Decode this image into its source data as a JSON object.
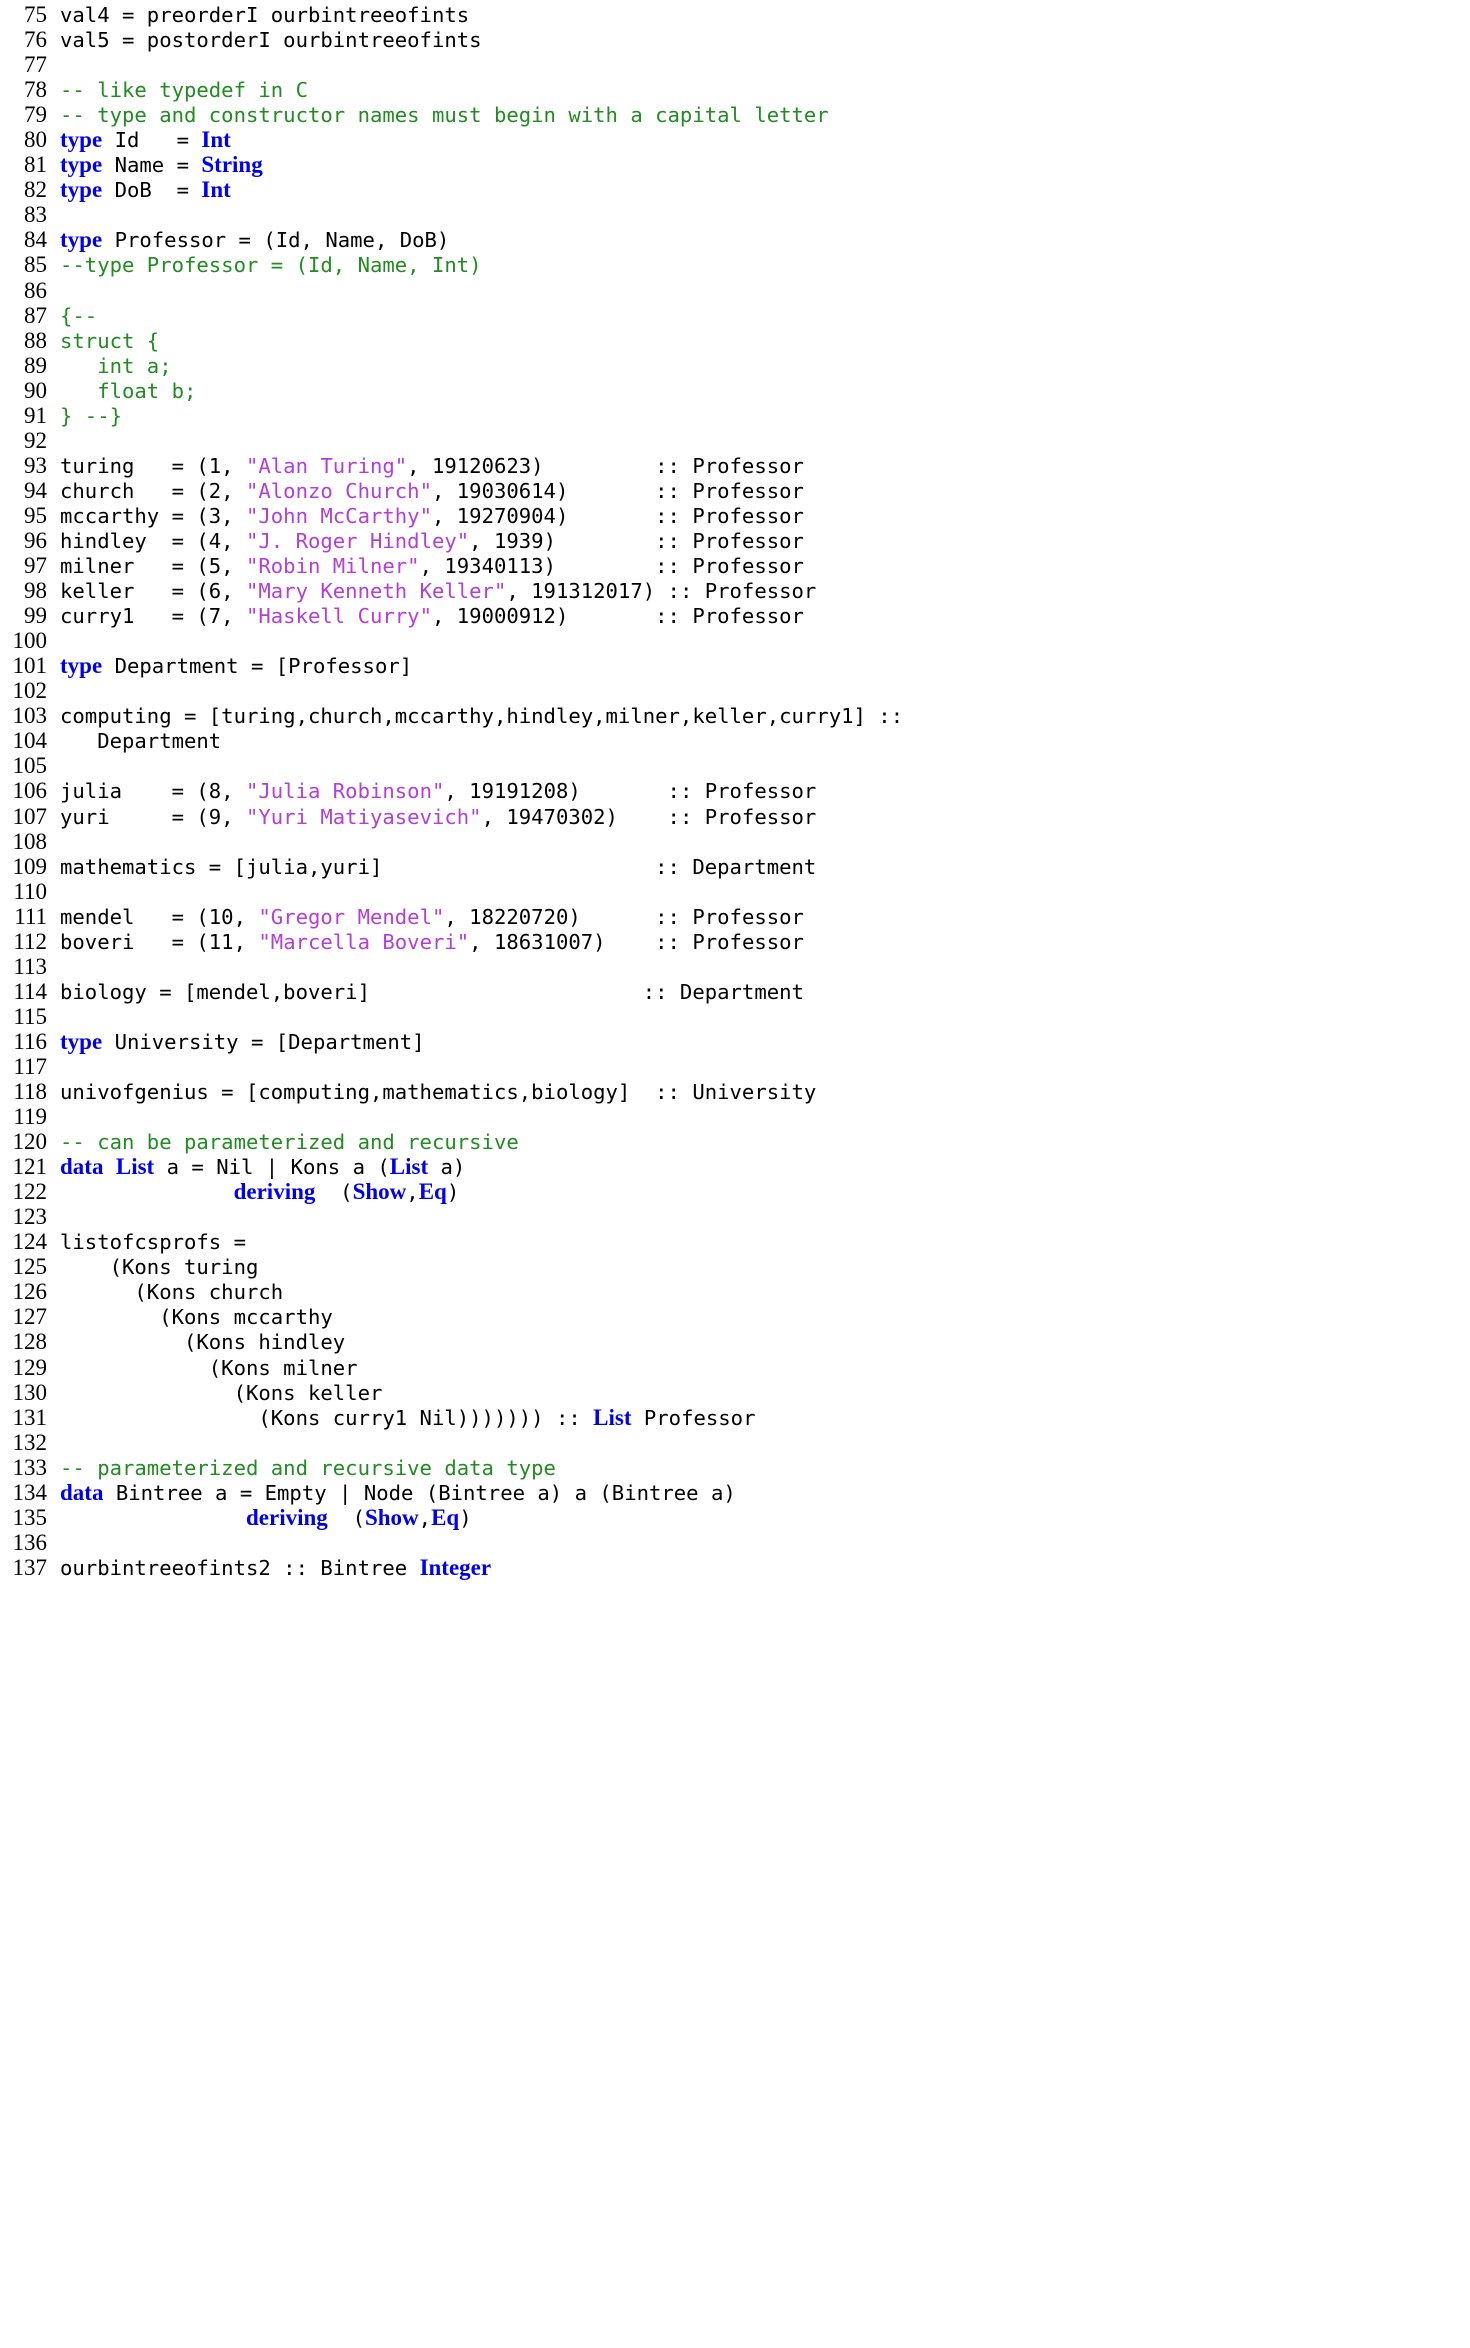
{
  "editor": {
    "language": "Haskell",
    "first_line_number": 75,
    "last_line_number": 137,
    "colors": {
      "background": "#ffffff",
      "default_text": "#000000",
      "keyword": "#0000EE",
      "type": "#0000EE",
      "comment": "#228B22",
      "string": "#B23FD8",
      "line_number": "#000000"
    }
  },
  "lines": [
    {
      "n": "75",
      "tokens": [
        {
          "t": "val4 = preorderI ourbintreeofints",
          "c": "pl"
        }
      ]
    },
    {
      "n": "76",
      "tokens": [
        {
          "t": "val5 = postorderI ourbintreeofints",
          "c": "pl"
        }
      ]
    },
    {
      "n": "77",
      "tokens": []
    },
    {
      "n": "78",
      "tokens": [
        {
          "t": "-- like typedef in C",
          "c": "cm"
        }
      ]
    },
    {
      "n": "79",
      "tokens": [
        {
          "t": "-- type and constructor names must begin with a capital letter",
          "c": "cm"
        }
      ]
    },
    {
      "n": "80",
      "tokens": [
        {
          "t": "type",
          "c": "kw"
        },
        {
          "t": " Id   = ",
          "c": "pl"
        },
        {
          "t": "Int",
          "c": "ty"
        }
      ]
    },
    {
      "n": "81",
      "tokens": [
        {
          "t": "type",
          "c": "kw"
        },
        {
          "t": " Name = ",
          "c": "pl"
        },
        {
          "t": "String",
          "c": "ty"
        }
      ]
    },
    {
      "n": "82",
      "tokens": [
        {
          "t": "type",
          "c": "kw"
        },
        {
          "t": " DoB  = ",
          "c": "pl"
        },
        {
          "t": "Int",
          "c": "ty"
        }
      ]
    },
    {
      "n": "83",
      "tokens": []
    },
    {
      "n": "84",
      "tokens": [
        {
          "t": "type",
          "c": "kw"
        },
        {
          "t": " Professor = (Id, Name, DoB)",
          "c": "pl"
        }
      ]
    },
    {
      "n": "85",
      "tokens": [
        {
          "t": "--type Professor = (Id, Name, Int)",
          "c": "cm"
        }
      ]
    },
    {
      "n": "86",
      "tokens": []
    },
    {
      "n": "87",
      "tokens": [
        {
          "t": "{--",
          "c": "cm"
        }
      ]
    },
    {
      "n": "88",
      "tokens": [
        {
          "t": "struct {",
          "c": "cm"
        }
      ]
    },
    {
      "n": "89",
      "tokens": [
        {
          "t": "   int a;",
          "c": "cm"
        }
      ]
    },
    {
      "n": "90",
      "tokens": [
        {
          "t": "   float b;",
          "c": "cm"
        }
      ]
    },
    {
      "n": "91",
      "tokens": [
        {
          "t": "} --}",
          "c": "cm"
        }
      ]
    },
    {
      "n": "92",
      "tokens": []
    },
    {
      "n": "93",
      "tokens": [
        {
          "t": "turing   = (1, ",
          "c": "pl"
        },
        {
          "t": "\"Alan Turing\"",
          "c": "st"
        },
        {
          "t": ", 19120623)         :: Professor",
          "c": "pl"
        }
      ]
    },
    {
      "n": "94",
      "tokens": [
        {
          "t": "church   = (2, ",
          "c": "pl"
        },
        {
          "t": "\"Alonzo Church\"",
          "c": "st"
        },
        {
          "t": ", 19030614)       :: Professor",
          "c": "pl"
        }
      ]
    },
    {
      "n": "95",
      "tokens": [
        {
          "t": "mccarthy = (3, ",
          "c": "pl"
        },
        {
          "t": "\"John McCarthy\"",
          "c": "st"
        },
        {
          "t": ", 19270904)       :: Professor",
          "c": "pl"
        }
      ]
    },
    {
      "n": "96",
      "tokens": [
        {
          "t": "hindley  = (4, ",
          "c": "pl"
        },
        {
          "t": "\"J. Roger Hindley\"",
          "c": "st"
        },
        {
          "t": ", 1939)        :: Professor",
          "c": "pl"
        }
      ]
    },
    {
      "n": "97",
      "tokens": [
        {
          "t": "milner   = (5, ",
          "c": "pl"
        },
        {
          "t": "\"Robin Milner\"",
          "c": "st"
        },
        {
          "t": ", 19340113)        :: Professor",
          "c": "pl"
        }
      ]
    },
    {
      "n": "98",
      "tokens": [
        {
          "t": "keller   = (6, ",
          "c": "pl"
        },
        {
          "t": "\"Mary Kenneth Keller\"",
          "c": "st"
        },
        {
          "t": ", 191312017) :: Professor",
          "c": "pl"
        }
      ]
    },
    {
      "n": "99",
      "tokens": [
        {
          "t": "curry1   = (7, ",
          "c": "pl"
        },
        {
          "t": "\"Haskell Curry\"",
          "c": "st"
        },
        {
          "t": ", 19000912)       :: Professor",
          "c": "pl"
        }
      ]
    },
    {
      "n": "100",
      "tokens": []
    },
    {
      "n": "101",
      "tokens": [
        {
          "t": "type",
          "c": "kw"
        },
        {
          "t": " Department = [Professor]",
          "c": "pl"
        }
      ]
    },
    {
      "n": "102",
      "tokens": []
    },
    {
      "n": "103",
      "tokens": [
        {
          "t": "computing = [turing,church,mccarthy,hindley,milner,keller,curry1] ::",
          "c": "pl"
        }
      ]
    },
    {
      "n": "104",
      "tokens": [
        {
          "t": "   Department",
          "c": "pl"
        }
      ]
    },
    {
      "n": "105",
      "tokens": []
    },
    {
      "n": "106",
      "tokens": [
        {
          "t": "julia    = (8, ",
          "c": "pl"
        },
        {
          "t": "\"Julia Robinson\"",
          "c": "st"
        },
        {
          "t": ", 19191208)       :: Professor",
          "c": "pl"
        }
      ]
    },
    {
      "n": "107",
      "tokens": [
        {
          "t": "yuri     = (9, ",
          "c": "pl"
        },
        {
          "t": "\"Yuri Matiyasevich\"",
          "c": "st"
        },
        {
          "t": ", 19470302)    :: Professor",
          "c": "pl"
        }
      ]
    },
    {
      "n": "108",
      "tokens": []
    },
    {
      "n": "109",
      "tokens": [
        {
          "t": "mathematics = [julia,yuri]                      :: Department",
          "c": "pl"
        }
      ]
    },
    {
      "n": "110",
      "tokens": []
    },
    {
      "n": "111",
      "tokens": [
        {
          "t": "mendel   = (10, ",
          "c": "pl"
        },
        {
          "t": "\"Gregor Mendel\"",
          "c": "st"
        },
        {
          "t": ", 18220720)      :: Professor",
          "c": "pl"
        }
      ]
    },
    {
      "n": "112",
      "tokens": [
        {
          "t": "boveri   = (11, ",
          "c": "pl"
        },
        {
          "t": "\"Marcella Boveri\"",
          "c": "st"
        },
        {
          "t": ", 18631007)    :: Professor",
          "c": "pl"
        }
      ]
    },
    {
      "n": "113",
      "tokens": []
    },
    {
      "n": "114",
      "tokens": [
        {
          "t": "biology = [mendel,boveri]                      :: Department",
          "c": "pl"
        }
      ]
    },
    {
      "n": "115",
      "tokens": []
    },
    {
      "n": "116",
      "tokens": [
        {
          "t": "type",
          "c": "kw"
        },
        {
          "t": " University = [Department]",
          "c": "pl"
        }
      ]
    },
    {
      "n": "117",
      "tokens": []
    },
    {
      "n": "118",
      "tokens": [
        {
          "t": "univofgenius = [computing,mathematics,biology]  :: University",
          "c": "pl"
        }
      ]
    },
    {
      "n": "119",
      "tokens": []
    },
    {
      "n": "120",
      "tokens": [
        {
          "t": "-- can be parameterized and recursive",
          "c": "cm"
        }
      ]
    },
    {
      "n": "121",
      "tokens": [
        {
          "t": "data",
          "c": "kw"
        },
        {
          "t": " ",
          "c": "pl"
        },
        {
          "t": "List",
          "c": "ty"
        },
        {
          "t": " a = Nil | Kons a (",
          "c": "pl"
        },
        {
          "t": "List",
          "c": "ty"
        },
        {
          "t": " a)",
          "c": "pl"
        }
      ]
    },
    {
      "n": "122",
      "tokens": [
        {
          "t": "              ",
          "c": "pl"
        },
        {
          "t": "deriving",
          "c": "kw"
        },
        {
          "t": "  (",
          "c": "pl"
        },
        {
          "t": "Show",
          "c": "ty"
        },
        {
          "t": ",",
          "c": "pl"
        },
        {
          "t": "Eq",
          "c": "ty"
        },
        {
          "t": ")",
          "c": "pl"
        }
      ]
    },
    {
      "n": "123",
      "tokens": []
    },
    {
      "n": "124",
      "tokens": [
        {
          "t": "listofcsprofs =",
          "c": "pl"
        }
      ]
    },
    {
      "n": "125",
      "tokens": [
        {
          "t": "    (Kons turing",
          "c": "pl"
        }
      ]
    },
    {
      "n": "126",
      "tokens": [
        {
          "t": "      (Kons church",
          "c": "pl"
        }
      ]
    },
    {
      "n": "127",
      "tokens": [
        {
          "t": "        (Kons mccarthy",
          "c": "pl"
        }
      ]
    },
    {
      "n": "128",
      "tokens": [
        {
          "t": "          (Kons hindley",
          "c": "pl"
        }
      ]
    },
    {
      "n": "129",
      "tokens": [
        {
          "t": "            (Kons milner",
          "c": "pl"
        }
      ]
    },
    {
      "n": "130",
      "tokens": [
        {
          "t": "              (Kons keller",
          "c": "pl"
        }
      ]
    },
    {
      "n": "131",
      "tokens": [
        {
          "t": "                (Kons curry1 Nil))))))) :: ",
          "c": "pl"
        },
        {
          "t": "List",
          "c": "ty"
        },
        {
          "t": " Professor",
          "c": "pl"
        }
      ]
    },
    {
      "n": "132",
      "tokens": []
    },
    {
      "n": "133",
      "tokens": [
        {
          "t": "-- parameterized and recursive data type",
          "c": "cm"
        }
      ]
    },
    {
      "n": "134",
      "tokens": [
        {
          "t": "data",
          "c": "kw"
        },
        {
          "t": " Bintree a = Empty | Node (Bintree a) a (Bintree a)",
          "c": "pl"
        }
      ]
    },
    {
      "n": "135",
      "tokens": [
        {
          "t": "               ",
          "c": "pl"
        },
        {
          "t": "deriving",
          "c": "kw"
        },
        {
          "t": "  (",
          "c": "pl"
        },
        {
          "t": "Show",
          "c": "ty"
        },
        {
          "t": ",",
          "c": "pl"
        },
        {
          "t": "Eq",
          "c": "ty"
        },
        {
          "t": ")",
          "c": "pl"
        }
      ]
    },
    {
      "n": "136",
      "tokens": []
    },
    {
      "n": "137",
      "tokens": [
        {
          "t": "ourbintreeofints2 :: Bintree ",
          "c": "pl"
        },
        {
          "t": "Integer",
          "c": "ty"
        }
      ]
    }
  ]
}
